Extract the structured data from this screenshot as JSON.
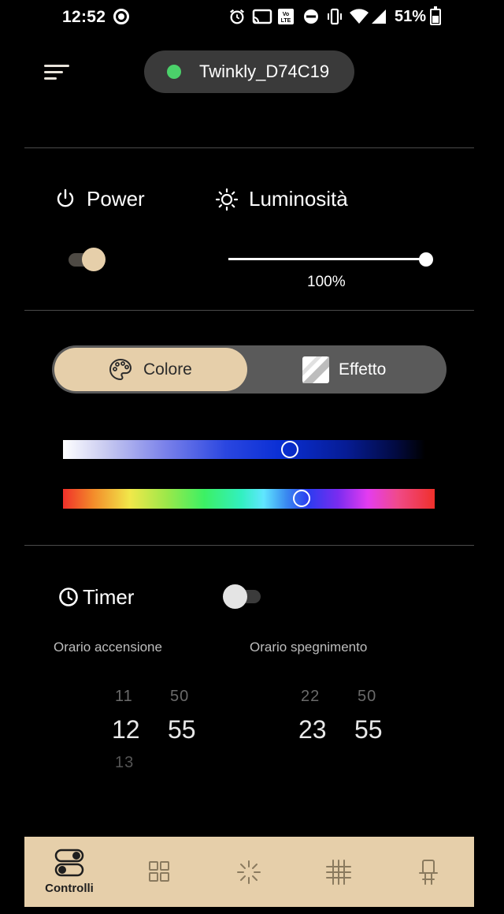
{
  "status_bar": {
    "time": "12:52",
    "battery": "51%"
  },
  "header": {
    "device_name": "Twinkly_D74C19",
    "device_status_color": "#4bd16a"
  },
  "controls": {
    "power_label": "Power",
    "power_on": true,
    "brightness_label": "Luminosità",
    "brightness_value": "100%",
    "brightness_level": 1.0
  },
  "mode_switch": {
    "active": "Colore",
    "color_label": "Colore",
    "effect_label": "Effetto"
  },
  "color": {
    "saturation_position": 0.62,
    "hue_position": 0.64
  },
  "timer": {
    "label": "Timer",
    "enabled": false,
    "on_time_label": "Orario accensione",
    "off_time_label": "Orario spegnimento",
    "on_time": {
      "hour_prev": "11",
      "hour": "12",
      "hour_next": "13",
      "minute_prev": "50",
      "minute": "55"
    },
    "off_time": {
      "hour_prev": "22",
      "hour": "23",
      "minute_prev": "50",
      "minute": "55"
    }
  },
  "bottom_nav": {
    "active_label": "Controlli",
    "items": [
      "controls-icon",
      "grid-icon",
      "sparkle-icon",
      "mapping-icon",
      "device-icon"
    ]
  },
  "colors": {
    "accent": "#e6cfaa",
    "background": "#000000"
  }
}
